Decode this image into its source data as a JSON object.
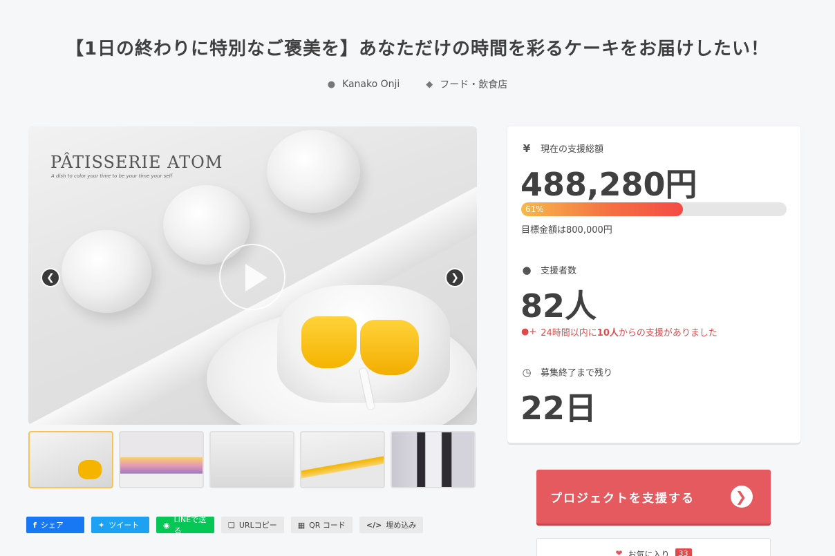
{
  "page": {
    "title": "【1日の終わりに特別なご褒美を】あなただけの時間を彩るケーキをお届けしたい！",
    "author": "Kanako Onji",
    "category": "フード・飲食店"
  },
  "hero": {
    "brand": "PÂTISSERIE ATOM",
    "brand_sub": "A dish to color your time to be your time your self"
  },
  "stats": {
    "total_label": "現在の支援総額",
    "total_value": "488,280円",
    "progress_percent": 61,
    "progress_label": "61%",
    "goal_text": "目標金額は800,000円",
    "supporters_label": "支援者数",
    "supporters_value": "82人",
    "recent_prefix": "24時間以内に",
    "recent_count": "10人",
    "recent_suffix": "からの支援がありました",
    "remaining_label": "募集終了まで残り",
    "remaining_value": "22日"
  },
  "share": {
    "facebook": "シェア",
    "twitter": "ツイート",
    "line": "LINEで送る",
    "url_copy": "URLコピー",
    "qr": "QR コード",
    "embed": "埋め込み"
  },
  "actions": {
    "support_label": "プロジェクトを支援する",
    "favorite_label": "お気に入り",
    "favorite_count": "33"
  },
  "colors": {
    "accent": "#e55a5e",
    "progress_start": "#f6b94a",
    "progress_end": "#f44b45",
    "alert": "#e04a4a",
    "facebook": "#1877f2",
    "twitter": "#1da1f2",
    "line": "#06c755"
  }
}
